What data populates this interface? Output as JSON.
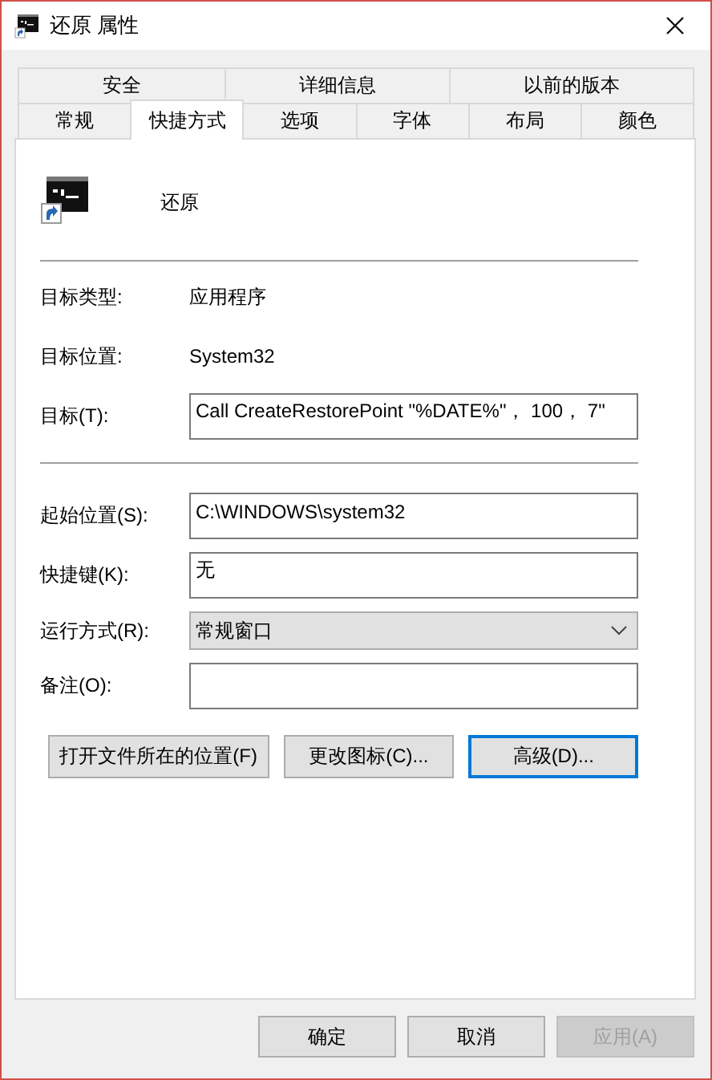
{
  "window": {
    "title": "还原 属性"
  },
  "tab_rows": [
    [
      {
        "label": "安全",
        "selected": false
      },
      {
        "label": "详细信息",
        "selected": false
      },
      {
        "label": "以前的版本",
        "selected": false
      }
    ],
    [
      {
        "label": "常规",
        "selected": false
      },
      {
        "label": "快捷方式",
        "selected": true
      },
      {
        "label": "选项",
        "selected": false
      },
      {
        "label": "字体",
        "selected": false
      },
      {
        "label": "布局",
        "selected": false
      },
      {
        "label": "颜色",
        "selected": false
      }
    ]
  ],
  "shortcut": {
    "name": "还原"
  },
  "fields": [
    {
      "kind": "text",
      "label": "目标类型:",
      "value": "应用程序"
    },
    {
      "kind": "text",
      "label": "目标位置:",
      "value": "System32"
    },
    {
      "kind": "input",
      "label": "目标(T):",
      "value": "Call CreateRestorePoint \"%DATE%\"， 100， 7\""
    },
    {
      "kind": "separator"
    },
    {
      "kind": "input",
      "label": "起始位置(S):",
      "value": "C:\\WINDOWS\\system32"
    },
    {
      "kind": "input",
      "label": "快捷键(K):",
      "value": "无"
    },
    {
      "kind": "select",
      "label": "运行方式(R):",
      "value": "常规窗口"
    },
    {
      "kind": "input",
      "label": "备注(O):"
    }
  ],
  "buttons": [
    {
      "label": "打开文件所在的位置(F)",
      "focused": false
    },
    {
      "label": "更改图标(C)...",
      "focused": false
    },
    {
      "label": "高级(D)...",
      "focused": true
    }
  ],
  "dialog_buttons": [
    {
      "label": "确定",
      "disabled": false
    },
    {
      "label": "取消",
      "disabled": false
    },
    {
      "label": "应用(A)",
      "disabled": true
    }
  ]
}
